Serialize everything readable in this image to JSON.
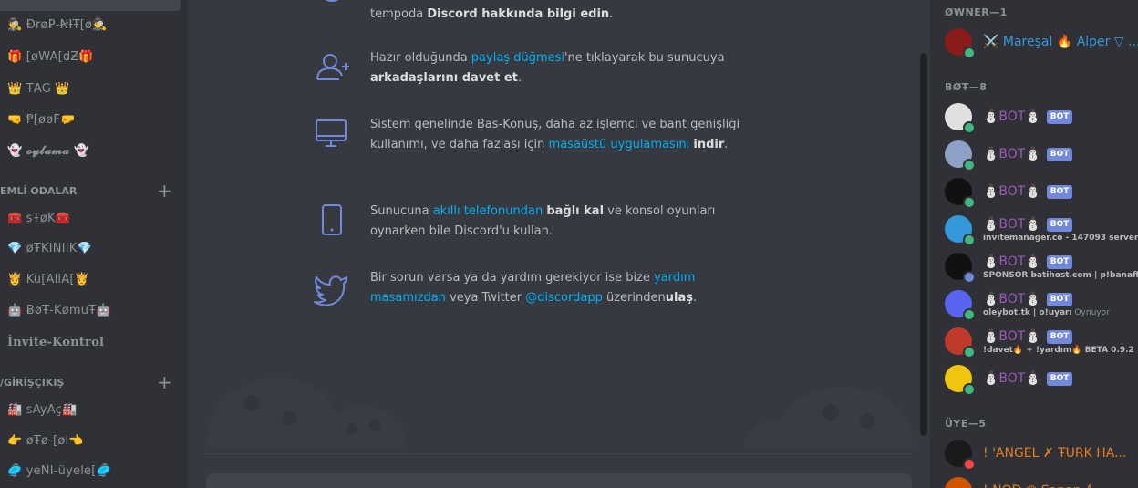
{
  "sidebar": {
    "channels_top": [
      {
        "label": "🕵️ ƉrøꝐ-ꞤƗŦ[ø🕵️",
        "bold": false
      },
      {
        "label": "🎁 [øWA[dƵ🎁",
        "bold": false
      },
      {
        "label": "👑 ŦAG 👑",
        "bold": false
      },
      {
        "label": "🤜 Ᵽ[øøF🤛",
        "bold": false
      },
      {
        "label": "👻 𝓸𝔂𝓵𝓪𝓶𝓪 👻",
        "bold": true
      }
    ],
    "category_1": "EMLİ ODALAR",
    "channels_mid": [
      {
        "label": "🧰 sŦøK🧰",
        "bold": false
      },
      {
        "label": "💎 øŦKINIIK💎",
        "bold": false
      },
      {
        "label": "👸 Ku[AllA[👸",
        "bold": false
      },
      {
        "label": "🤖 ɃøŦ-KømuŦ🤖",
        "bold": false
      },
      {
        "label": "İnvite-Kontrol",
        "bold": true
      }
    ],
    "category_2": "/GİRİŞÇIKIŞ",
    "channels_bottom": [
      {
        "label": "🏭 sAyAç🏭",
        "bold": false
      },
      {
        "label": "👉 øŦø-[øl👈",
        "bold": false
      },
      {
        "label": "🥏 yeNI-üyele[🥏",
        "bold": false
      }
    ],
    "add_symbol": "+"
  },
  "tips": [
    {
      "icon": "question-icon",
      "parts": [
        {
          "t": "tempoda ",
          "k": "p"
        },
        {
          "t": "Discord hakkında bilgi edin",
          "k": "b"
        },
        {
          "t": ".",
          "k": "p"
        }
      ]
    },
    {
      "icon": "add-friend-icon",
      "parts": [
        {
          "t": "Hazır olduğunda ",
          "k": "p"
        },
        {
          "t": "paylaş düğmesi",
          "k": "l"
        },
        {
          "t": "'ne tıklayarak bu sunucuya ",
          "k": "p"
        },
        {
          "t": "arkadaşlarını davet et",
          "k": "b"
        },
        {
          "t": ".",
          "k": "p"
        }
      ]
    },
    {
      "icon": "monitor-icon",
      "parts": [
        {
          "t": "Sistem genelinde Bas-Konuş, daha az işlemci ve bant genişliği kullanımı, ve daha fazlası için ",
          "k": "p"
        },
        {
          "t": "masaüstü uygulamasını",
          "k": "l"
        },
        {
          "t": " ",
          "k": "p"
        },
        {
          "t": "indir",
          "k": "b"
        },
        {
          "t": ".",
          "k": "p"
        }
      ]
    },
    {
      "icon": "phone-icon",
      "parts": [
        {
          "t": "Sunucuna ",
          "k": "p"
        },
        {
          "t": "akıllı telefonundan",
          "k": "l"
        },
        {
          "t": " ",
          "k": "p"
        },
        {
          "t": "bağlı kal",
          "k": "b"
        },
        {
          "t": " ve konsol oyunları oynarken bile Discord'u kullan.",
          "k": "p"
        }
      ]
    },
    {
      "icon": "twitter-icon",
      "parts": [
        {
          "t": "Bir sorun varsa ya da yardım gerekiyor ise bize ",
          "k": "p"
        },
        {
          "t": "yardım masamızdan",
          "k": "l"
        },
        {
          "t": " veya Twitter ",
          "k": "p"
        },
        {
          "t": "@discordapp",
          "k": "l"
        },
        {
          "t": " üzerinden",
          "k": "p"
        },
        {
          "t": "ulaş",
          "k": "b"
        },
        {
          "t": ".",
          "k": "p"
        }
      ]
    }
  ],
  "members": {
    "owner_header": "ØWNER—1",
    "owner": {
      "name": "⚔️ Mareşal 🔥 Alper ▽ ...",
      "color": "#3498db",
      "avatar_color": "#8b1a1a",
      "status": "online"
    },
    "bot_header": "BØŦ—8",
    "bot_tag": "BOT",
    "bots": [
      {
        "name": "⛄BOT⛄",
        "activity": "",
        "activity_thin": "",
        "avatar_color": "#e0e0e0",
        "status_color": "#43b581"
      },
      {
        "name": "⛄BOT⛄",
        "activity": "",
        "activity_thin": "",
        "avatar_color": "#8ea0c8",
        "status_color": "#43b581"
      },
      {
        "name": "⛄BOT⛄",
        "activity": "",
        "activity_thin": "",
        "avatar_color": "#111111",
        "status_color": "#43b581"
      },
      {
        "name": "⛄BOT⛄",
        "activity": "invitemanager.co - 147093 server...",
        "activity_thin": "",
        "avatar_color": "#3498db",
        "status_color": "#43b581"
      },
      {
        "name": "⛄BOT⛄",
        "activity": "SPONSOR batihost.com | p!banaff...",
        "activity_thin": "",
        "avatar_color": "#111111",
        "status_color": "#7289da"
      },
      {
        "name": "⛄BOT⛄",
        "activity": "oleybot.tk | o!uyarı",
        "activity_thin": " Oynuyor",
        "avatar_color": "#5865f2",
        "status_color": "#43b581"
      },
      {
        "name": "⛄BOT⛄",
        "activity": "!davet🔥 + !yardım🔥 BETA 0.9.2 ...",
        "activity_thin": "",
        "avatar_color": "#c0392b",
        "status_color": "#43b581"
      },
      {
        "name": "⛄BOT⛄",
        "activity": "",
        "activity_thin": "",
        "avatar_color": "#f1c40f",
        "status_color": "#43b581"
      }
    ],
    "member_header": "ÜYE—5",
    "users": [
      {
        "name": "! 'ANGEL ✗ ŦURK HA...",
        "color": "#e67e22",
        "avatar_color": "#1a1a1a",
        "status_color": "#f04747"
      },
      {
        "name": "! NOD ♛ Sanan A...",
        "color": "#e67e22",
        "avatar_color": "#d35400",
        "status_color": "#43b581"
      }
    ]
  }
}
